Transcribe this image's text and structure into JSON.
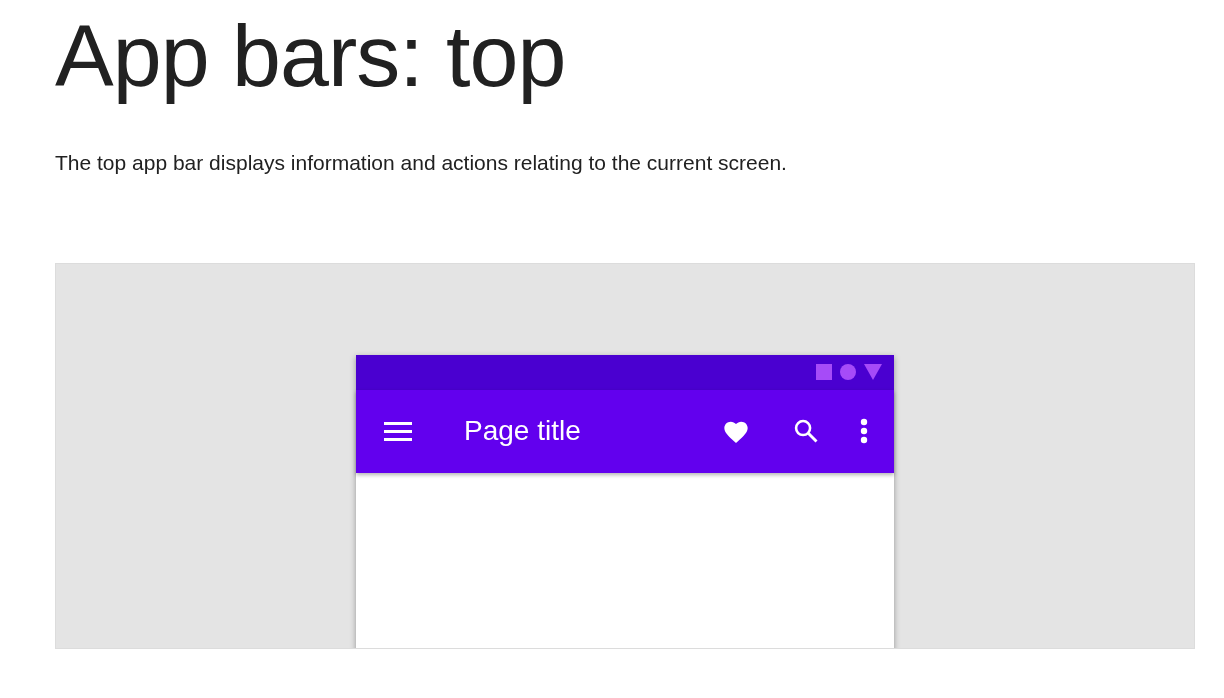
{
  "heading": "App bars: top",
  "description": "The top app bar displays information and actions relating to the current screen.",
  "demo": {
    "app_bar": {
      "title": "Page title"
    }
  }
}
